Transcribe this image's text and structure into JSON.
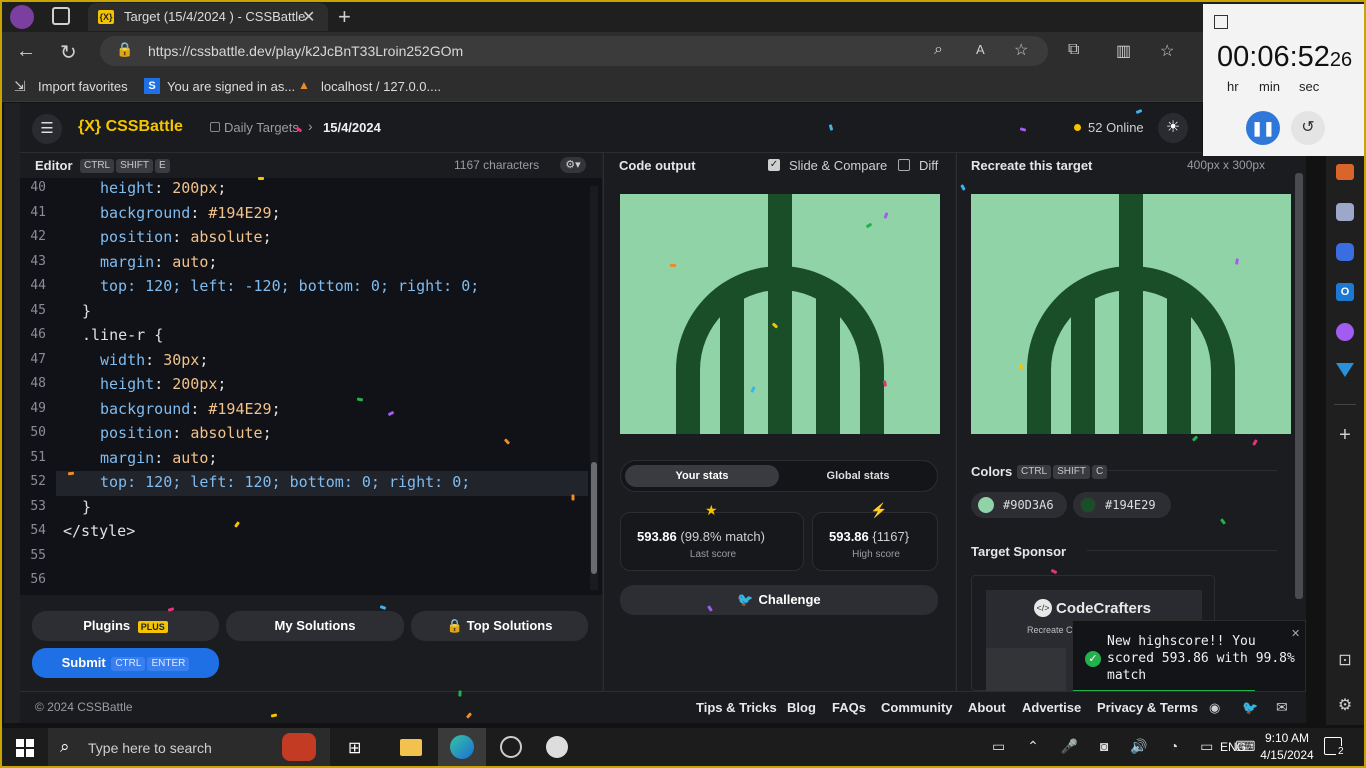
{
  "browser": {
    "tab_title": "Target (15/4/2024 ) - CSSBattle",
    "url": "https://cssbattle.dev/play/k2JcBnT33Lroin252GOm",
    "favorites": [
      "Import favorites",
      "You are signed in as...",
      "localhost / 127.0.0...."
    ]
  },
  "timer": {
    "hms": "00:06:52",
    "ms": "26",
    "labels": [
      "hr",
      "min",
      "sec"
    ]
  },
  "nav": {
    "logo": "{X} CSSBattle",
    "crumb1": "Daily Targets",
    "crumb2": "15/4/2024",
    "online": "52 Online"
  },
  "editor": {
    "title": "Editor",
    "keys": [
      "CTRL",
      "SHIFT",
      "E"
    ],
    "chars": "1167 characters",
    "lines": [
      {
        "n": "40",
        "i": 1,
        "p": "height",
        "v": "200px"
      },
      {
        "n": "41",
        "i": 1,
        "p": "background",
        "v": "#194E29"
      },
      {
        "n": "42",
        "i": 1,
        "p": "position",
        "v": "absolute"
      },
      {
        "n": "43",
        "i": 1,
        "p": "margin",
        "v": "auto"
      },
      {
        "n": "44",
        "i": 1,
        "raw": "top: 120; left: -120; bottom: 0; right: 0;"
      },
      {
        "n": "45",
        "i": 0,
        "raw": "}"
      },
      {
        "n": "46",
        "i": 0,
        "raw": ".line-r {"
      },
      {
        "n": "47",
        "i": 1,
        "p": "width",
        "v": "30px"
      },
      {
        "n": "48",
        "i": 1,
        "p": "height",
        "v": "200px"
      },
      {
        "n": "49",
        "i": 1,
        "p": "background",
        "v": "#194E29"
      },
      {
        "n": "50",
        "i": 1,
        "p": "position",
        "v": "absolute"
      },
      {
        "n": "51",
        "i": 1,
        "p": "margin",
        "v": "auto"
      },
      {
        "n": "52",
        "i": 1,
        "raw": "top: 120; left: 120; bottom: 0; right: 0;"
      },
      {
        "n": "53",
        "i": 0,
        "raw": "}"
      },
      {
        "n": "54",
        "i": -1,
        "raw": "</style>"
      },
      {
        "n": "55",
        "i": 0,
        "raw": ""
      },
      {
        "n": "56",
        "i": 0,
        "raw": ""
      }
    ]
  },
  "buttons": {
    "plugins": "Plugins",
    "plus": "PLUS",
    "my_solutions": "My Solutions",
    "top_solutions": "Top Solutions",
    "submit": "Submit",
    "submit_keys": [
      "CTRL",
      "ENTER"
    ]
  },
  "output": {
    "title": "Code output",
    "slide": "Slide & Compare",
    "diff": "Diff",
    "tab_your": "Your stats",
    "tab_global": "Global stats",
    "last_score": "593.86",
    "last_match": "(99.8% match)",
    "last_label": "Last score",
    "high_score": "593.86",
    "high_chars": "{1167}",
    "high_label": "High score",
    "challenge": "Challenge"
  },
  "target": {
    "title": "Recreate this target",
    "size": "400px x 300px",
    "colors_label": "Colors",
    "color_keys": [
      "CTRL",
      "SHIFT",
      "C"
    ],
    "colors": [
      "#90D3A6",
      "#194E29"
    ],
    "sponsor_label": "Target Sponsor",
    "sponsor": "CodeCrafters",
    "sponsor_sub": "Recreate Cod"
  },
  "toast": "New highscore!! You scored 593.86 with 99.8% match",
  "footer": {
    "copyright": "© 2024 CSSBattle",
    "links": [
      "Tips & Tricks",
      "Blog",
      "FAQs",
      "Community",
      "About",
      "Advertise",
      "Privacy & Terms"
    ]
  },
  "taskbar": {
    "search": "Type here to search",
    "lang": "ENG",
    "time": "9:10 AM",
    "date": "4/15/2024",
    "notif": "2"
  },
  "palette": {
    "bg": "#90D3A6",
    "fg": "#194E29",
    "accent": "#1f6fe5"
  }
}
